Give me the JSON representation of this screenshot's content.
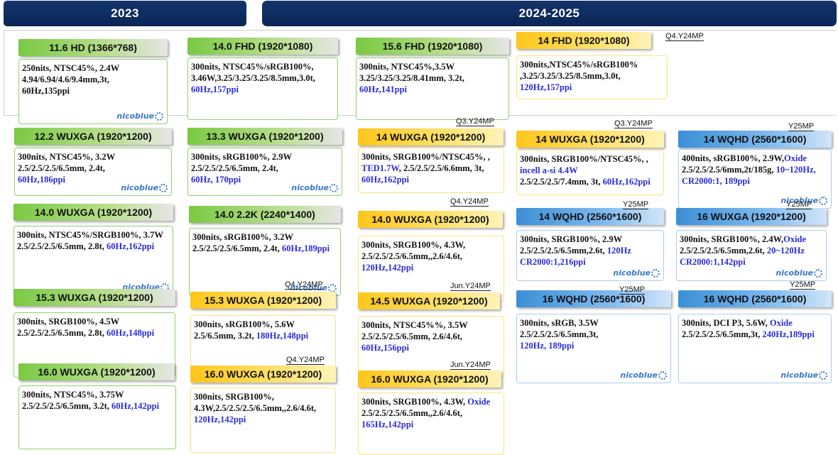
{
  "years": {
    "y2023": "2023",
    "y2024": "2024-2025"
  },
  "logo_text": "nicoblue",
  "cards": [
    {
      "id": "c1",
      "title": "11.6 HD (1366*768)",
      "style": "green",
      "logo": true,
      "tag": "",
      "lines": [
        [
          {
            "t": "250nits, NTSC45%, 2.4W"
          }
        ],
        [
          {
            "t": "4.94/6.94/4.6/9.4mm,3t,"
          }
        ],
        [
          {
            "t": "60Hz,135ppi"
          }
        ]
      ]
    },
    {
      "id": "c2",
      "title": "14.0 FHD (1920*1080)",
      "style": "green",
      "logo": false,
      "tag": "",
      "lines": [
        [
          {
            "t": "300nits, NTSC45%/sRGB100%,"
          }
        ],
        [
          {
            "t": "3.46W,3.25/3.25/3.25/8.5mm,3.0t,"
          }
        ],
        [
          {
            "t": "60Hz,157ppi",
            "h": 1
          }
        ]
      ]
    },
    {
      "id": "c3",
      "title": "15.6 FHD (1920*1080)",
      "style": "green",
      "logo": false,
      "tag": "",
      "lines": [
        [
          {
            "t": "300nits, NTSC45%,3.5W"
          }
        ],
        [
          {
            "t": "3.25/3.25/3.25/8.41mm, 3.2t,"
          }
        ],
        [
          {
            "t": "60Hz,141ppi",
            "h": 1
          }
        ]
      ]
    },
    {
      "id": "c4",
      "title": "14 FHD (1920*1080)",
      "style": "yellow",
      "logo": false,
      "tag": "Q4.Y24MP",
      "lines": [
        [
          {
            "t": "300nits,NTSC45%/sRGB100%"
          }
        ],
        [
          {
            "t": ",3.25/3.25/3.25/8.5mm,3.0t,"
          }
        ],
        [
          {
            "t": "120Hz,157ppi",
            "h": 1
          }
        ]
      ]
    },
    {
      "id": "c5",
      "title": "12.2 WUXGA (1920*1200)",
      "style": "green",
      "logo": true,
      "tag": "",
      "lines": [
        [
          {
            "t": "300nits, NTSC45%, 3.2W"
          }
        ],
        [
          {
            "t": "2.5/2.5/2.5/6.5mm, 2.4t,"
          }
        ],
        [
          {
            "t": "60Hz,186ppi",
            "h": 1
          }
        ]
      ]
    },
    {
      "id": "c6",
      "title": "13.3 WUXGA (1920*1200)",
      "style": "green",
      "logo": true,
      "tag": "",
      "lines": [
        [
          {
            "t": "300nits, sRGB100%, 2.9W"
          }
        ],
        [
          {
            "t": "2.5/2.5/2.5/6.5mm, 2.4t,"
          }
        ],
        [
          {
            "t": "60Hz, 170ppi",
            "h": 1
          }
        ]
      ]
    },
    {
      "id": "c7",
      "title": "14 WUXGA (1920*1200)",
      "style": "yellow",
      "logo": false,
      "tag": "Q3.Y24MP",
      "lines": [
        [
          {
            "t": "300nits, SRGB100%/NTSC45%, ,"
          }
        ],
        [
          {
            "t": "TED1.7W",
            "h": 1
          },
          {
            "t": ", 2.5/2.5/2.5/6.6mm, 3t,"
          }
        ],
        [
          {
            "t": "60Hz,162ppi",
            "h": 1
          }
        ]
      ]
    },
    {
      "id": "c8",
      "title": "14 WUXGA (1920*1200)",
      "style": "yellow",
      "logo": false,
      "tag": "Q3.Y24MP",
      "lines": [
        [
          {
            "t": "300nits, SRGB100%/NTSC45%, ,"
          }
        ],
        [
          {
            "t": "incell a-si 4.4W",
            "h": 1
          }
        ],
        [
          {
            "t": "2.5/2.5/2.5/7.4mm, 3t, "
          },
          {
            "t": "60Hz,162ppi",
            "h": 1
          }
        ]
      ]
    },
    {
      "id": "c9",
      "title": "14 WQHD (2560*1600)",
      "style": "blue",
      "logo": true,
      "tag": "Y25MP",
      "lines": [
        [
          {
            "t": "400nits, sRGB100%, 2.9W,"
          },
          {
            "t": "Oxide",
            "h": 1
          }
        ],
        [
          {
            "t": "2.5/2.5/2.5/6mm,2t/185g, "
          },
          {
            "t": "10~120Hz,",
            "h": 1
          }
        ],
        [
          {
            "t": "CR2000:1, 189ppi",
            "h": 1
          }
        ]
      ]
    },
    {
      "id": "c10",
      "title": "14.0 WUXGA (1920*1200)",
      "style": "green",
      "logo": true,
      "tag": "",
      "lines": [
        [
          {
            "t": "300nits, NTSC45%/SRGB100%, 3.7W"
          }
        ],
        [
          {
            "t": "2.5/2.5/2.5/6.5mm, 2.8t, "
          },
          {
            "t": "60Hz,162ppi",
            "h": 1
          }
        ]
      ]
    },
    {
      "id": "c11",
      "title": "14.0 2.2K (2240*1400)",
      "style": "green",
      "logo": true,
      "tag": "",
      "lines": [
        [
          {
            "t": "300nits, sRGB100%, 3.2W"
          }
        ],
        [
          {
            "t": "2.5/2.5/2.5/6.5mm, 2.4t, "
          },
          {
            "t": "60Hz,189ppi",
            "h": 1
          }
        ]
      ]
    },
    {
      "id": "c12",
      "title": "14.0 WUXGA (1920*1200)",
      "style": "yellow",
      "logo": false,
      "tag": "Q4.Y24MP",
      "lines": [
        [
          {
            "t": "300nits, SRGB100%, 4.3W,"
          }
        ],
        [
          {
            "t": "2.5/2.5/2.5/6.5mm,,2.6/4.6t,"
          }
        ],
        [
          {
            "t": "120Hz,142ppi",
            "h": 1
          }
        ]
      ]
    },
    {
      "id": "c13",
      "title": "14 WQHD (2560*1600)",
      "style": "blue",
      "logo": true,
      "tag": "Y25MP",
      "lines": [
        [
          {
            "t": "300nits, SRGB100%, 2.9W"
          }
        ],
        [
          {
            "t": "2.5/2.5/2.5/6.5mm,2.6t, "
          },
          {
            "t": "120Hz",
            "h": 1
          }
        ],
        [
          {
            "t": "CR2000:1,216ppi",
            "h": 1
          }
        ]
      ]
    },
    {
      "id": "c14",
      "title": "16 WUXGA (1920*1200)",
      "style": "blue",
      "logo": true,
      "tag": "Y25MP",
      "lines": [
        [
          {
            "t": "300nits, SRGB100%, 2.4W,"
          },
          {
            "t": "Oxide",
            "h": 1
          }
        ],
        [
          {
            "t": "2.5/2.5/2.5/6.5mm,2.6t, "
          },
          {
            "t": "20~120Hz",
            "h": 1
          }
        ],
        [
          {
            "t": "CR2000:1,142ppi",
            "h": 1
          }
        ]
      ]
    },
    {
      "id": "c15",
      "title": "15.3 WUXGA (1920*1200)",
      "style": "green",
      "logo": false,
      "tag": "",
      "lines": [
        [
          {
            "t": "300nits, SRGB100%, 4.5W"
          }
        ],
        [
          {
            "t": "2.5/2.5/2.5/6.5mm, 2.8t, "
          },
          {
            "t": "60Hz,148ppi",
            "h": 1
          }
        ]
      ]
    },
    {
      "id": "c16",
      "title": "15.3 WUXGA (1920*1200)",
      "style": "yellow",
      "logo": false,
      "tag": "Q4.Y24MP",
      "lines": [
        [
          {
            "t": "300nits, sRGB100%, 5.6W"
          }
        ],
        [
          {
            "t": "2.5/6.5mm, 3.2t, "
          },
          {
            "t": "180Hz,148ppi",
            "h": 1
          }
        ]
      ]
    },
    {
      "id": "c17",
      "title": "14.5 WUXGA (1920*1200)",
      "style": "yellow",
      "logo": false,
      "tag": "Jun.Y24MP",
      "lines": [
        [
          {
            "t": "300nits, NTSC45%%, 3.5W"
          }
        ],
        [
          {
            "t": "2.5/2.5/2.5/6.5mm, 2.6/4.6t,"
          }
        ],
        [
          {
            "t": "60Hz,156ppi",
            "h": 1
          }
        ]
      ]
    },
    {
      "id": "c18",
      "title": "16 WQHD (2560*1600)",
      "style": "blue",
      "logo": true,
      "tag": "Y25MP",
      "lines": [
        [
          {
            "t": "300nits, sRGB, 3.5W"
          }
        ],
        [
          {
            "t": "2.5/2.5/2.5/6.5mm,3t,"
          }
        ],
        [
          {
            "t": "120Hz, 189ppi",
            "h": 1
          }
        ]
      ]
    },
    {
      "id": "c19",
      "title": "16 WQHD (2560*1600)",
      "style": "blue",
      "logo": true,
      "tag": "Y25MP",
      "lines": [
        [
          {
            "t": "300nits, DCI P3, 5.6W, "
          },
          {
            "t": "Oxide",
            "h": 1
          }
        ],
        [
          {
            "t": "2.5/2.5/2.5/6.5mm,3t, "
          },
          {
            "t": "240Hz,189ppi",
            "h": 1
          }
        ]
      ]
    },
    {
      "id": "c20",
      "title": "16.0 WUXGA (1920*1200)",
      "style": "green",
      "logo": false,
      "tag": "",
      "lines": [
        [
          {
            "t": "300nits, NTSC45%, 3.75W"
          }
        ],
        [
          {
            "t": "2.5/2.5/2.5/6.5mm, 3.2t, "
          },
          {
            "t": "60Hz,142ppi",
            "h": 1
          }
        ]
      ]
    },
    {
      "id": "c21",
      "title": "16.0 WUXGA (1920*1200)",
      "style": "yellow",
      "logo": false,
      "tag": "Q4.Y24MP",
      "lines": [
        [
          {
            "t": "300nits, SRGB100%,"
          }
        ],
        [
          {
            "t": "4.3W,2.5/2.5/2.5/6.5mm,,2.6/4.6t,"
          }
        ],
        [
          {
            "t": "120Hz,142ppi",
            "h": 1
          }
        ]
      ]
    },
    {
      "id": "c22",
      "title": "16.0 WUXGA (1920*1200)",
      "style": "yellow",
      "logo": false,
      "tag": "Jun.Y24MP",
      "lines": [
        [
          {
            "t": "300nits, SRGB100%, 4.3W, "
          },
          {
            "t": "Oxide",
            "h": 1
          }
        ],
        [
          {
            "t": "2.5/2.5/2.5/6.5mm,,2.6/4.6t,"
          }
        ],
        [
          {
            "t": "165Hz,142ppi",
            "h": 1
          }
        ]
      ]
    }
  ]
}
